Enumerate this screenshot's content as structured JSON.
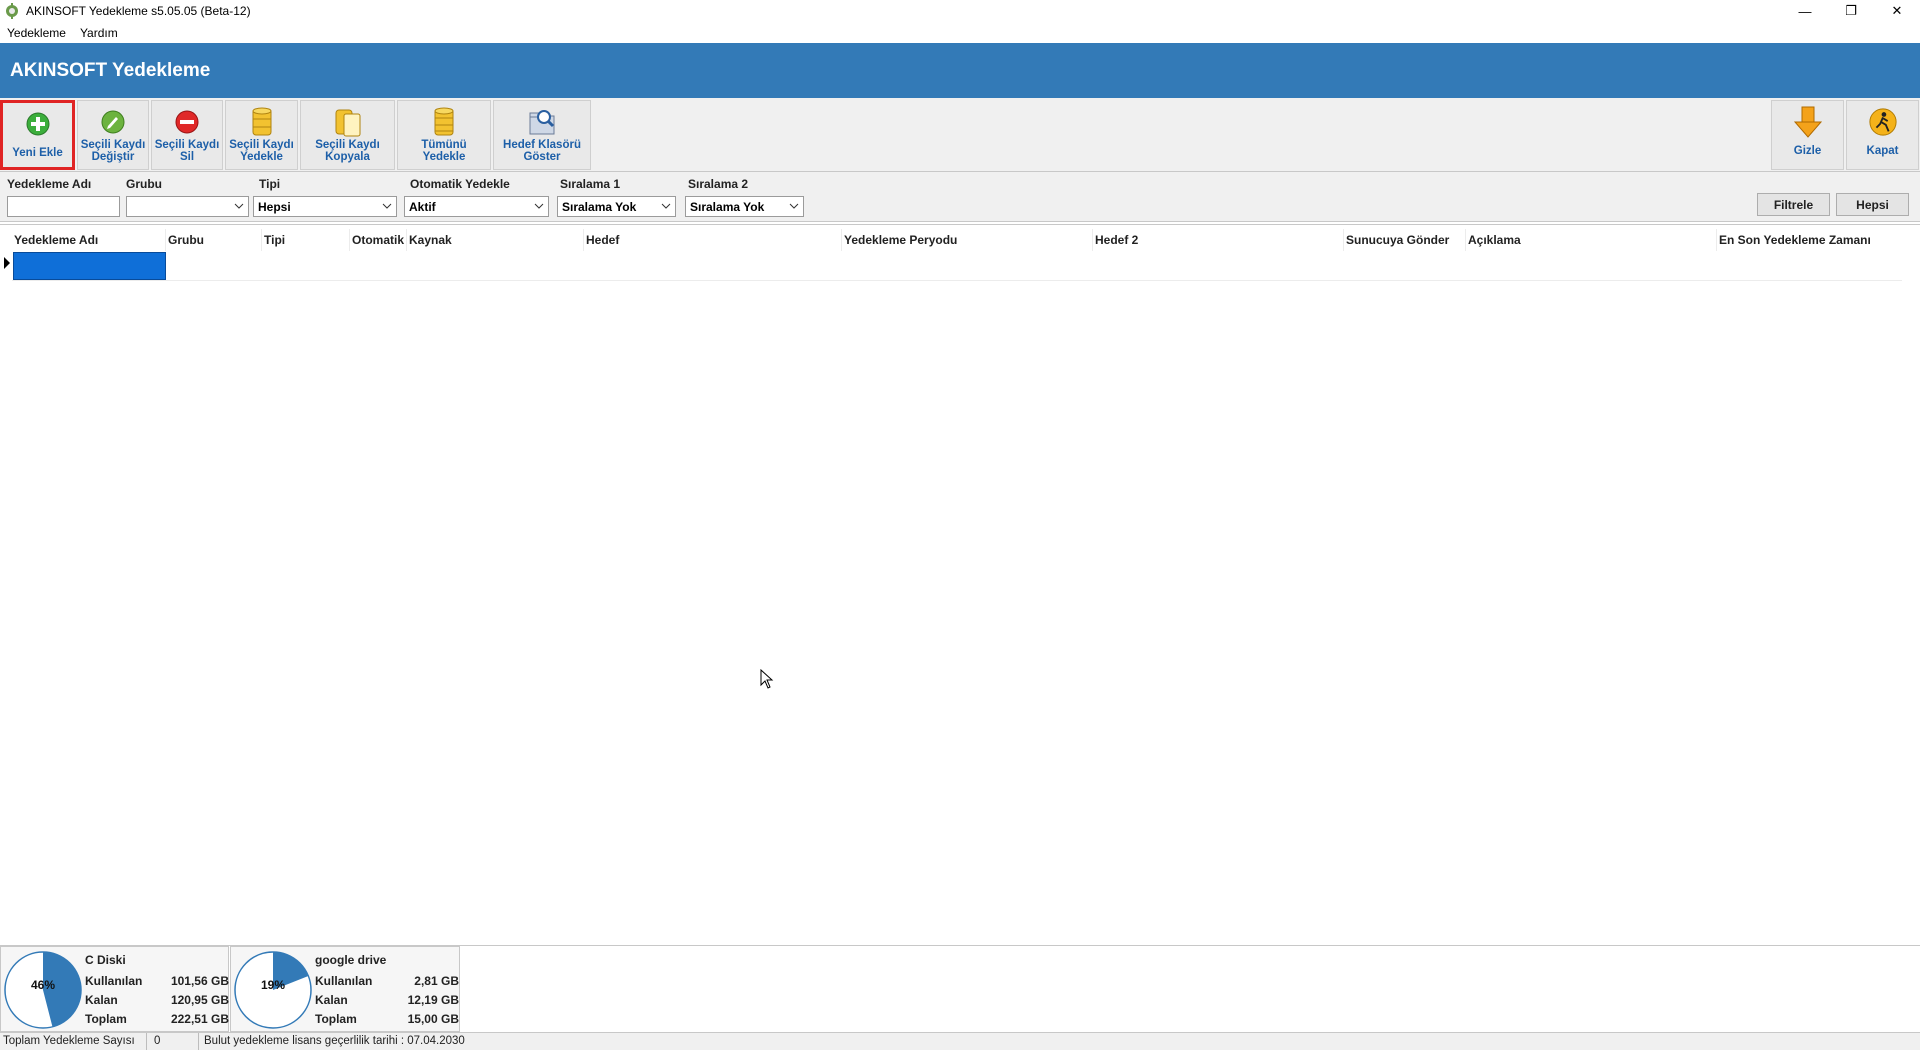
{
  "window": {
    "title": "AKINSOFT Yedekleme s5.05.05 (Beta-12)",
    "minimize_glyph": "—",
    "maximize_glyph": "❐",
    "close_glyph": "✕"
  },
  "menu": {
    "items": [
      {
        "label": "Yedekleme"
      },
      {
        "label": "Yardım"
      }
    ]
  },
  "header": {
    "title": "AKINSOFT Yedekleme",
    "color": "#337ab7"
  },
  "toolbar": {
    "buttons": [
      {
        "label": "Yeni Ekle",
        "icon": "plus-circle-icon",
        "active": true
      },
      {
        "label": "Seçili Kaydı\nDeğiştir",
        "icon": "edit-circle-icon"
      },
      {
        "label": "Seçili Kaydı\nSil",
        "icon": "minus-circle-icon"
      },
      {
        "label": "Seçili Kaydı\nYedekle",
        "icon": "database-backup-icon"
      },
      {
        "label": "Seçili Kaydı\nKopyala",
        "icon": "database-copy-icon"
      },
      {
        "label": "Tümünü\nYedekle",
        "icon": "database-all-icon"
      },
      {
        "label": "Hedef Klasörü\nGöster",
        "icon": "folder-search-icon"
      }
    ],
    "right_buttons": [
      {
        "label": "Gizle",
        "icon": "arrow-down-icon"
      },
      {
        "label": "Kapat",
        "icon": "exit-icon"
      }
    ]
  },
  "filters": {
    "name_label": "Yedekleme Adı",
    "name_value": "",
    "group_label": "Grubu",
    "group_value": "",
    "type_label": "Tipi",
    "type_value": "Hepsi",
    "auto_label": "Otomatik Yedekle",
    "auto_value": "Aktif",
    "sort1_label": "Sıralama 1",
    "sort1_value": "Sıralama Yok",
    "sort2_label": "Sıralama 2",
    "sort2_value": "Sıralama Yok",
    "filter_button": "Filtrele",
    "all_button": "Hepsi"
  },
  "grid": {
    "columns": [
      "Yedekleme Adı",
      "Grubu",
      "Tipi",
      "Otomatik",
      "Kaynak",
      "Hedef",
      "Yedekleme Peryodu",
      "Hedef 2",
      "Sunucuya Gönder",
      "Açıklama",
      "En Son Yedekleme Zamanı"
    ]
  },
  "disks": [
    {
      "name": "C Diski",
      "percent": "46%",
      "used_fraction": 0.46,
      "used_label": "Kullanılan",
      "used": "101,56 GB",
      "free_label": "Kalan",
      "free": "120,95 GB",
      "total_label": "Toplam",
      "total": "222,51 GB"
    },
    {
      "name": "google drive",
      "percent": "19%",
      "used_fraction": 0.19,
      "used_label": "Kullanılan",
      "used": "2,81 GB",
      "free_label": "Kalan",
      "free": "12,19 GB",
      "total_label": "Toplam",
      "total": "15,00 GB"
    }
  ],
  "status": {
    "count_label": "Toplam Yedekleme Sayısı",
    "count": "0",
    "license": "Bulut yedekleme lisans geçerlilik tarihi : 07.04.2030"
  },
  "colors": {
    "accent": "#337ab7",
    "toolbar_text": "#1d5fa8",
    "selection": "#0f6fd8",
    "active_border": "#e02424"
  }
}
